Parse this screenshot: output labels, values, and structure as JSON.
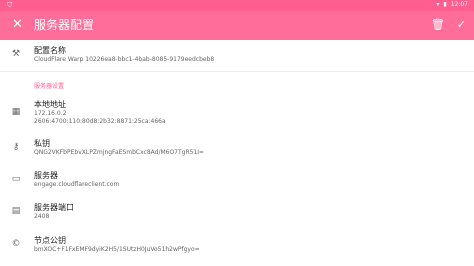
{
  "statusbar": {
    "time": "12:07"
  },
  "toolbar": {
    "title": "服务器配置",
    "close_icon": "close-icon",
    "delete_icon": "trash-icon",
    "save_icon": "check-icon"
  },
  "config_name": {
    "label": "配置名称",
    "value": "CloudFlare Warp 10226ea8-bbc1-4bab-8085-9179eedcbeb8"
  },
  "section_title": "服务器设置",
  "local_address": {
    "label": "本地地址",
    "value1": "172.16.0.2",
    "value2": "2606:4700:110:80d8:2b32:8871:25ca:466a"
  },
  "private_key": {
    "label": "私钥",
    "value": "QNG2VKFbPEbvXLPZmjngFaESmbCxc8Ad/M6O7TgR51I="
  },
  "server": {
    "label": "服务器",
    "value": "engage.cloudflareclient.com"
  },
  "server_port": {
    "label": "服务器端口",
    "value": "2408"
  },
  "public_key": {
    "label": "节点公钥",
    "value": "bmXOC+F1FxEMF9dyiK2H5/1SUtzH0JuVo51h2wPfgyo="
  }
}
